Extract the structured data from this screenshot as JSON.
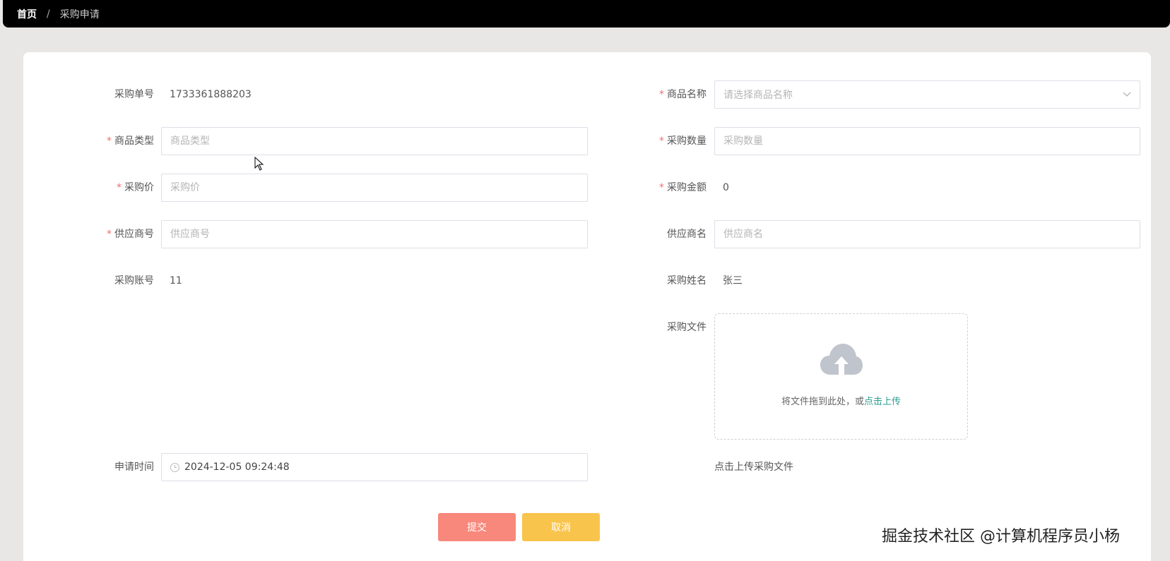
{
  "breadcrumb": {
    "home": "首页",
    "separator": "/",
    "current": "采购申请"
  },
  "form": {
    "order_no": {
      "label": "采购单号",
      "value": "1733361888203"
    },
    "product_name": {
      "label": "商品名称",
      "placeholder": "请选择商品名称",
      "required": true
    },
    "product_type": {
      "label": "商品类型",
      "placeholder": "商品类型",
      "required": true
    },
    "quantity": {
      "label": "采购数量",
      "placeholder": "采购数量",
      "required": true
    },
    "price": {
      "label": "采购价",
      "placeholder": "采购价",
      "required": true
    },
    "amount": {
      "label": "采购金额",
      "value": "0",
      "required": true
    },
    "supplier_no": {
      "label": "供应商号",
      "placeholder": "供应商号",
      "required": true
    },
    "supplier_name": {
      "label": "供应商名",
      "placeholder": "供应商名"
    },
    "account": {
      "label": "采购账号",
      "value": "11"
    },
    "buyer_name": {
      "label": "采购姓名",
      "value": "张三"
    },
    "file": {
      "label": "采购文件",
      "drop_text": "将文件拖到此处，或",
      "link_text": "点击上传",
      "tip": "点击上传采购文件"
    },
    "apply_time": {
      "label": "申请时间",
      "value": "2024-12-05 09:24:48"
    }
  },
  "buttons": {
    "submit": "提交",
    "cancel": "取消"
  },
  "watermark": "掘金技术社区 @计算机程序员小杨",
  "colors": {
    "required": "#f56c6c",
    "submit": "#f8887b",
    "cancel": "#f9c44c",
    "link": "#2a9d8f"
  },
  "icons": {
    "dropdown": "chevron-down-icon",
    "time": "clock-icon",
    "upload": "cloud-upload-icon"
  }
}
